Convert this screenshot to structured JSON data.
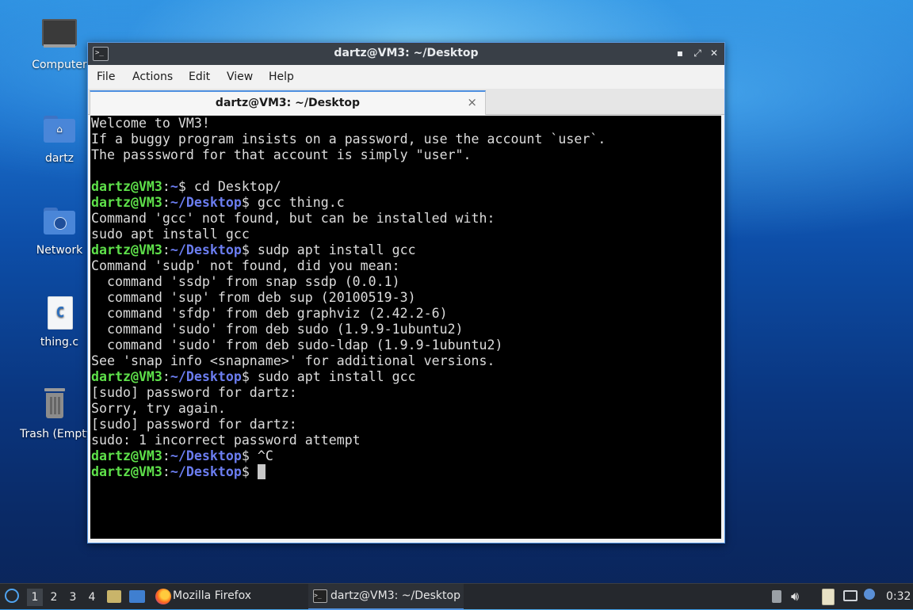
{
  "desktop": {
    "icons": [
      {
        "label": "Computer",
        "icon": "computer-icon"
      },
      {
        "label": "dartz",
        "icon": "home-folder-icon"
      },
      {
        "label": "Network",
        "icon": "network-folder-icon"
      },
      {
        "label": "thing.c",
        "icon": "c-source-file-icon",
        "glyph": "C"
      },
      {
        "label": "Trash (Empty)",
        "icon": "trash-icon"
      }
    ]
  },
  "window": {
    "title": "dartz@VM3: ~/Desktop",
    "title_icon": "terminal-icon",
    "controls": {
      "minimize": "▪",
      "maximize": "⤢",
      "close": "✕"
    },
    "menu": [
      "File",
      "Actions",
      "Edit",
      "View",
      "Help"
    ],
    "tab": {
      "title": "dartz@VM3: ~/Desktop",
      "close": "×"
    },
    "accent": "#5294e2"
  },
  "terminal": {
    "lines": [
      {
        "text": "Welcome to VM3!"
      },
      {
        "text": "If a buggy program insists on a password, use the account `user`."
      },
      {
        "text": "The passsword for that account is simply \"user\"."
      },
      {
        "text": ""
      },
      {
        "user": "dartz@VM3",
        "path": "~",
        "cmd": "$ cd Desktop/"
      },
      {
        "user": "dartz@VM3",
        "path": "~/Desktop",
        "cmd": "$ gcc thing.c"
      },
      {
        "text": "Command 'gcc' not found, but can be installed with:"
      },
      {
        "text": "sudo apt install gcc"
      },
      {
        "user": "dartz@VM3",
        "path": "~/Desktop",
        "cmd": "$ sudp apt install gcc"
      },
      {
        "text": "Command 'sudp' not found, did you mean:"
      },
      {
        "text": "  command 'ssdp' from snap ssdp (0.0.1)"
      },
      {
        "text": "  command 'sup' from deb sup (20100519-3)"
      },
      {
        "text": "  command 'sfdp' from deb graphviz (2.42.2-6)"
      },
      {
        "text": "  command 'sudo' from deb sudo (1.9.9-1ubuntu2)"
      },
      {
        "text": "  command 'sudo' from deb sudo-ldap (1.9.9-1ubuntu2)"
      },
      {
        "text": "See 'snap info <snapname>' for additional versions."
      },
      {
        "user": "dartz@VM3",
        "path": "~/Desktop",
        "cmd": "$ sudo apt install gcc"
      },
      {
        "text": "[sudo] password for dartz:"
      },
      {
        "text": "Sorry, try again."
      },
      {
        "text": "[sudo] password for dartz:"
      },
      {
        "text": "sudo: 1 incorrect password attempt"
      },
      {
        "user": "dartz@VM3",
        "path": "~/Desktop",
        "cmd": "$ ^C"
      },
      {
        "user": "dartz@VM3",
        "path": "~/Desktop",
        "cmd": "$ ",
        "cursor": true
      }
    ],
    "colors": {
      "user": "#5ee04a",
      "path": "#6b7df0",
      "text": "#dcdcdc",
      "background": "#000000"
    }
  },
  "taskbar": {
    "start_icon": "lubuntu-start-icon",
    "workspaces": [
      "1",
      "2",
      "3",
      "4"
    ],
    "active_workspace": "1",
    "launchers": [
      "file-manager-icon",
      "show-desktop-icon"
    ],
    "tasks": [
      {
        "label": "Mozilla Firefox",
        "icon": "firefox-icon",
        "active": false
      },
      {
        "label": "dartz@VM3: ~/Desktop",
        "icon": "terminal-icon",
        "active": true
      }
    ],
    "tray": [
      "removable-media-icon",
      "volume-icon",
      "clipboard-icon",
      "network-wired-icon",
      "update-notifier-icon"
    ],
    "clock": "0:32"
  }
}
